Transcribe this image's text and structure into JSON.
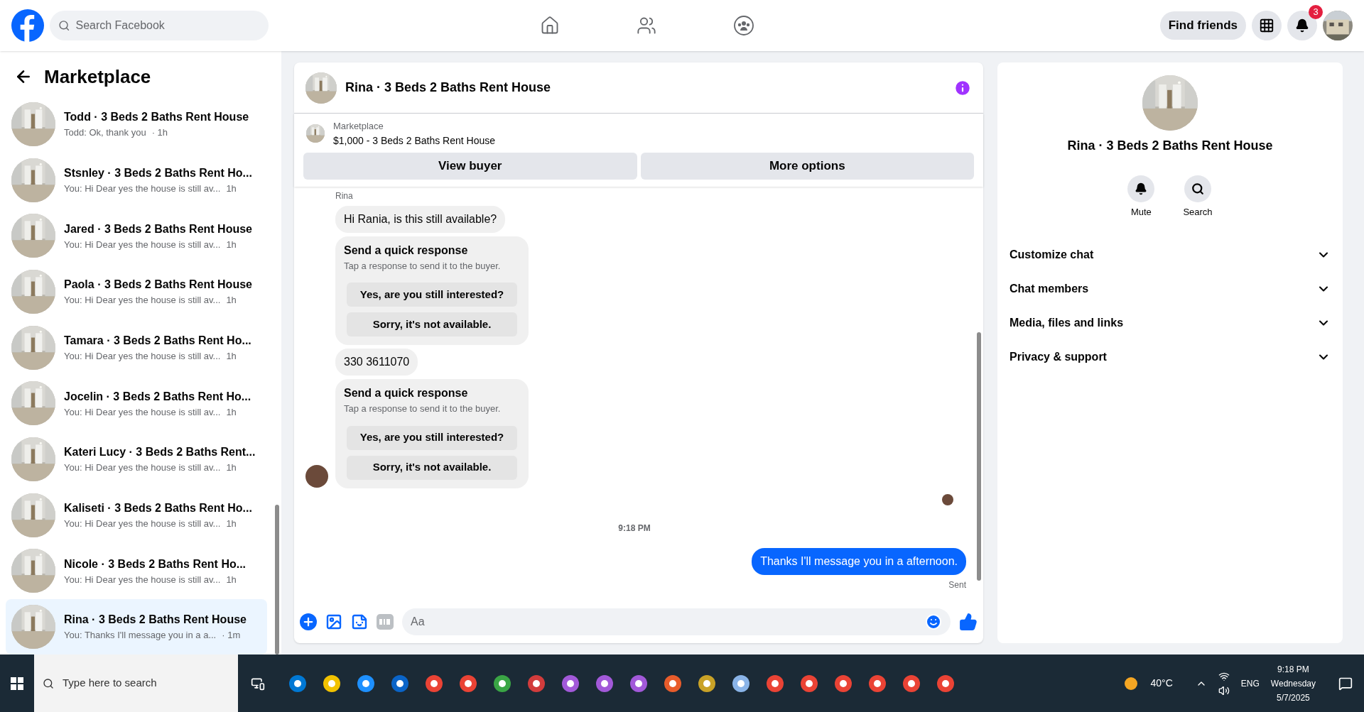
{
  "topbar": {
    "search_placeholder": "Search Facebook",
    "find_friends": "Find friends",
    "notification_count": "3"
  },
  "sidebar": {
    "title": "Marketplace",
    "conversations": [
      {
        "title": "Todd · 3 Beds 2 Baths Rent House",
        "preview": "Todd: Ok, thank you",
        "time": "· 1h",
        "selected": false
      },
      {
        "title": "Stsnley · 3 Beds 2 Baths Rent Ho...",
        "preview": "You: Hi Dear yes the house is still av...",
        "time": "1h",
        "selected": false
      },
      {
        "title": "Jared · 3 Beds 2 Baths Rent House",
        "preview": "You: Hi Dear yes the house is still av...",
        "time": "1h",
        "selected": false
      },
      {
        "title": "Paola · 3 Beds 2 Baths Rent House",
        "preview": "You: Hi Dear yes the house is still av...",
        "time": "1h",
        "selected": false
      },
      {
        "title": "Tamara · 3 Beds 2 Baths Rent Ho...",
        "preview": "You: Hi Dear yes the house is still av...",
        "time": "1h",
        "selected": false
      },
      {
        "title": "Jocelin · 3 Beds 2 Baths Rent Ho...",
        "preview": "You: Hi Dear yes the house is still av...",
        "time": "1h",
        "selected": false
      },
      {
        "title": "Kateri Lucy · 3 Beds 2 Baths Rent...",
        "preview": "You: Hi Dear yes the house is still av...",
        "time": "1h",
        "selected": false
      },
      {
        "title": "Kaliseti · 3 Beds 2 Baths Rent Ho...",
        "preview": "You: Hi Dear yes the house is still av...",
        "time": "1h",
        "selected": false
      },
      {
        "title": "Nicole · 3 Beds 2 Baths Rent Ho...",
        "preview": "You: Hi Dear yes the house is still av...",
        "time": "1h",
        "selected": false
      },
      {
        "title": "Rina · 3 Beds 2 Baths Rent House",
        "preview": "You: Thanks I'll message you in a a...",
        "time": "· 1m",
        "selected": true
      }
    ]
  },
  "chat": {
    "title": "Rina · 3 Beds 2 Baths Rent House",
    "listing_label": "Marketplace",
    "listing": "$1,000 - 3 Beds 2 Baths Rent House",
    "buttons": [
      "View buyer",
      "More options"
    ],
    "messages": [
      {
        "kind": "sender",
        "text": "Rina"
      },
      {
        "kind": "incoming",
        "text": "Hi Rania, is this still available?"
      },
      {
        "kind": "quick_response",
        "title": "Send a quick response",
        "subtitle": "Tap a response to send it to the buyer.",
        "options": [
          "Yes, are you still interested?",
          "Sorry, it's not available."
        ]
      },
      {
        "kind": "incoming",
        "text": "330 3611070"
      },
      {
        "kind": "quick_response",
        "title": "Send a quick response",
        "subtitle": "Tap a response to send it to the buyer.",
        "options": [
          "Yes, are you still interested?",
          "Sorry, it's not available."
        ]
      },
      {
        "kind": "timestamp",
        "text": "9:18 PM"
      },
      {
        "kind": "outgoing",
        "text": "Thanks I'll message you in a afternoon."
      },
      {
        "kind": "status",
        "text": "Sent"
      }
    ],
    "composer_placeholder": "Aa"
  },
  "info_panel": {
    "title": "Rina · 3 Beds 2 Baths Rent House",
    "actions": [
      {
        "kind": "mute",
        "label": "Mute"
      },
      {
        "kind": "search",
        "label": "Search"
      }
    ],
    "sections": [
      {
        "label": "Customize chat",
        "expanded": false
      },
      {
        "label": "Chat members",
        "expanded": false
      },
      {
        "label": "Media, files and links",
        "expanded": false
      },
      {
        "label": "Privacy & support",
        "expanded": false
      }
    ]
  },
  "taskbar": {
    "search_placeholder": "Type here to search",
    "weather": "40°C",
    "language": "ENG",
    "time": "9:18 PM",
    "day": "Wednesday",
    "date": "5/7/2025"
  }
}
